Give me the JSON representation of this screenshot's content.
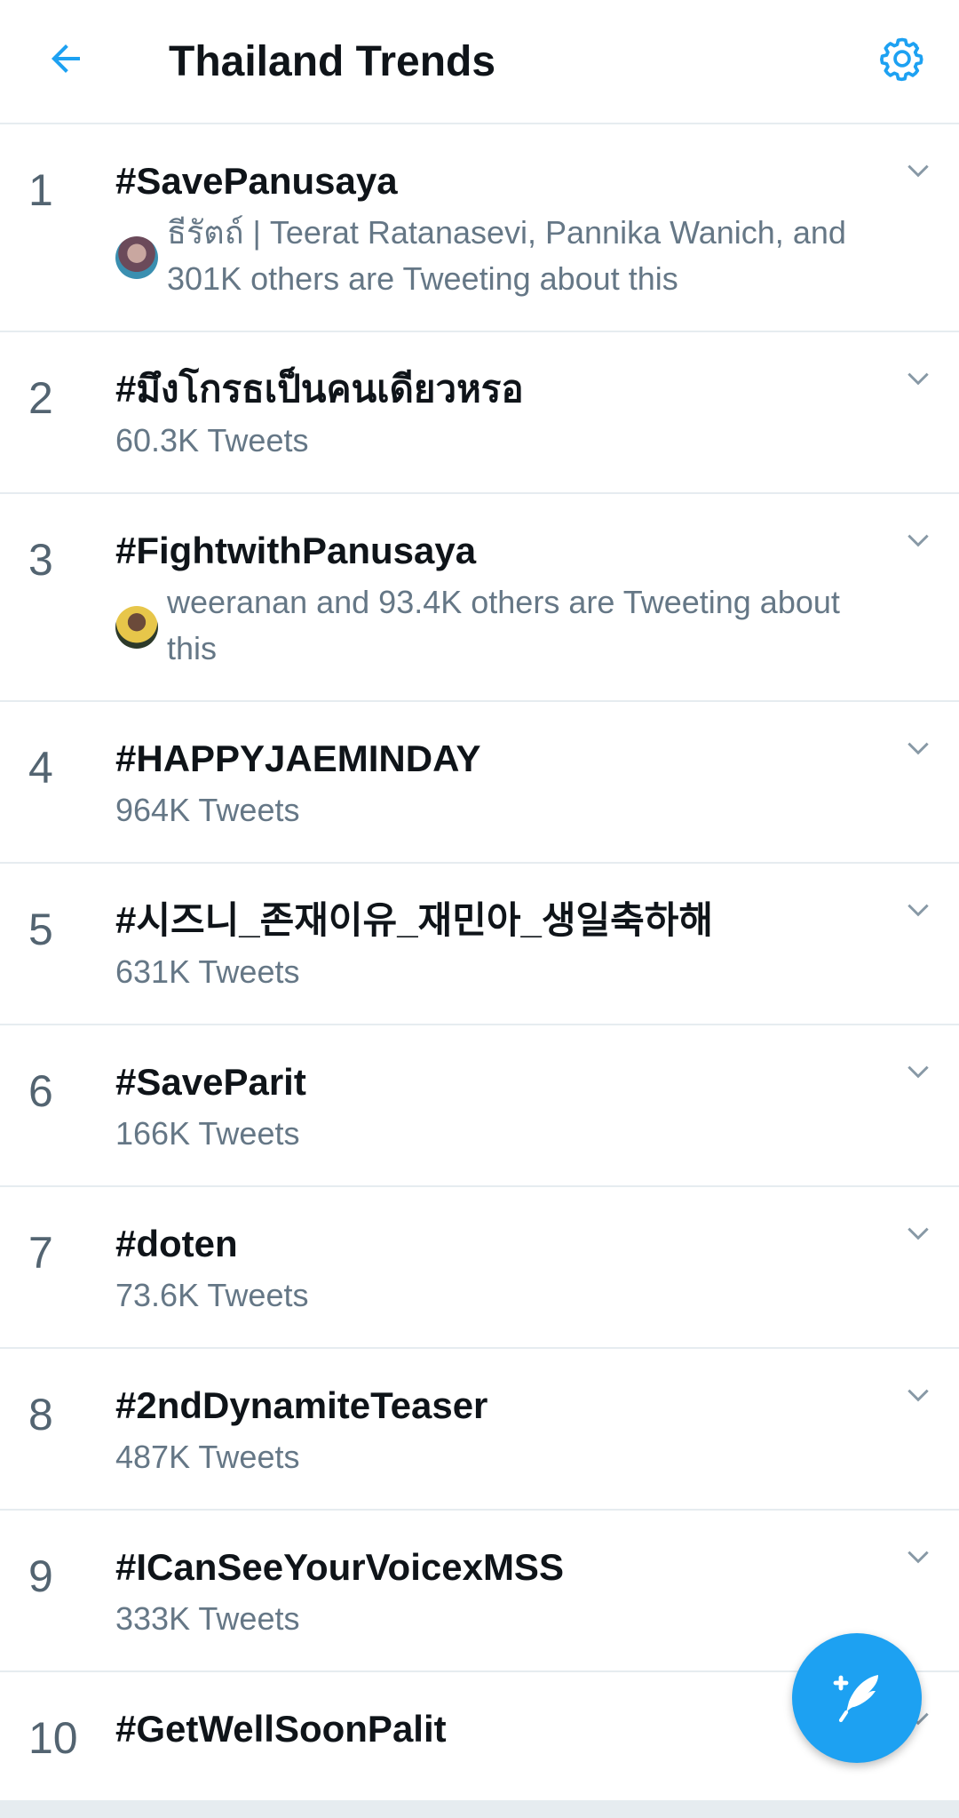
{
  "header": {
    "title": "Thailand Trends",
    "accent": "#1da1f2"
  },
  "trends": [
    {
      "rank": "1",
      "name": "#SavePanusaya",
      "meta": "ธีรัตถ์ | Teerat Ratanasevi, Pannika Wanich, and 301K others are Tweeting about this",
      "has_avatar": true
    },
    {
      "rank": "2",
      "name": "#มึงโกรธเป็นคนเดียวหรอ",
      "meta": "60.3K Tweets",
      "has_avatar": false
    },
    {
      "rank": "3",
      "name": "#FightwithPanusaya",
      "meta": "weeranan and 93.4K others are Tweeting about this",
      "has_avatar": true
    },
    {
      "rank": "4",
      "name": "#HAPPYJAEMINDAY",
      "meta": "964K Tweets",
      "has_avatar": false
    },
    {
      "rank": "5",
      "name": "#시즈니_존재이유_재민아_생일축하해",
      "meta": "631K Tweets",
      "has_avatar": false
    },
    {
      "rank": "6",
      "name": "#SaveParit",
      "meta": "166K Tweets",
      "has_avatar": false
    },
    {
      "rank": "7",
      "name": "#doten",
      "meta": "73.6K Tweets",
      "has_avatar": false
    },
    {
      "rank": "8",
      "name": "#2ndDynamiteTeaser",
      "meta": "487K Tweets",
      "has_avatar": false
    },
    {
      "rank": "9",
      "name": "#ICanSeeYourVoicexMSS",
      "meta": "333K Tweets",
      "has_avatar": false
    },
    {
      "rank": "10",
      "name": "#GetWellSoonPalit",
      "meta": "",
      "has_avatar": false
    }
  ],
  "icons": {
    "back": "arrow-left-icon",
    "settings": "gear-icon",
    "expand": "chevron-down-icon",
    "compose": "compose-tweet-icon"
  }
}
